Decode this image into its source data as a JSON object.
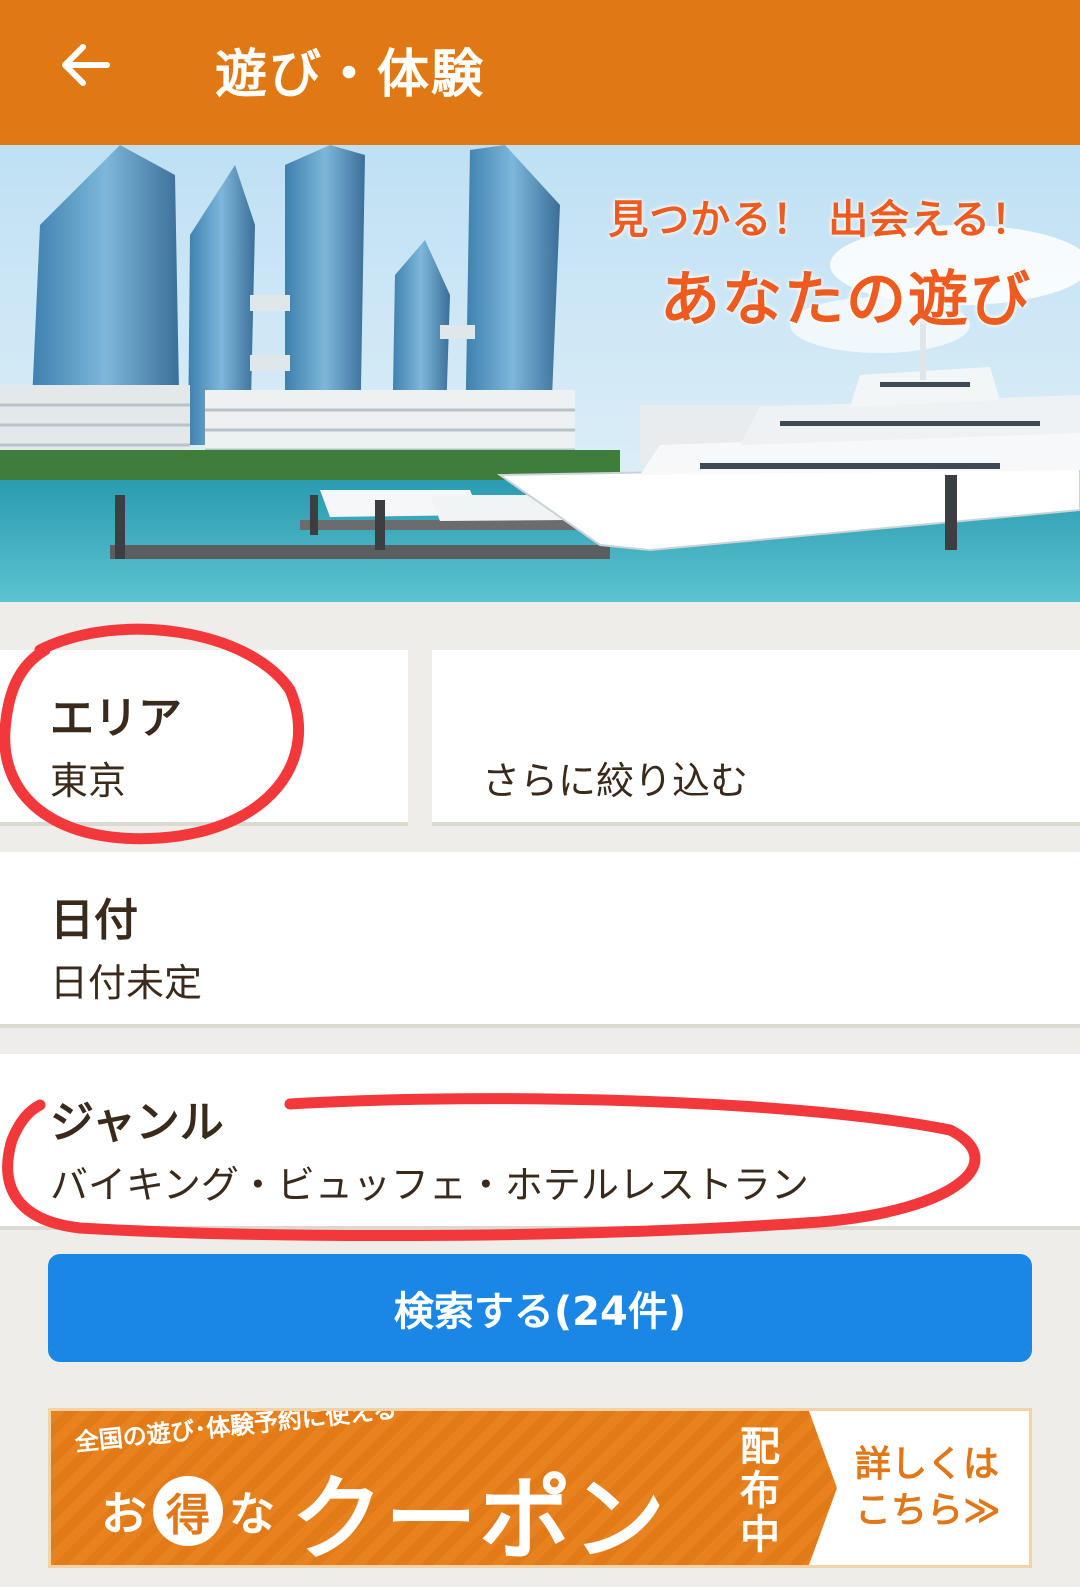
{
  "header": {
    "title": "遊び・体験",
    "back_icon": "arrow-left-icon"
  },
  "hero": {
    "tagline_line1": "見つかる！ 出会える！",
    "tagline_line2": "あなたの遊び"
  },
  "filters": {
    "area": {
      "label": "エリア",
      "value": "東京"
    },
    "refine": {
      "label": "さらに絞り込む"
    },
    "date": {
      "label": "日付",
      "value": "日付未定"
    },
    "genre": {
      "label": "ジャンル",
      "value": "バイキング・ビュッフェ・ホテルレストラン"
    }
  },
  "search": {
    "label": "検索する(24件)"
  },
  "coupon": {
    "subtitle": "全国の遊び･体験予約に使える",
    "prefix": "お",
    "circle_char": "得",
    "middle": "な",
    "main": "クーポン",
    "vertical": "配布中",
    "detail_line1": "詳しくは",
    "detail_line2": "こちら≫"
  },
  "colors": {
    "header_bg": "#e07814",
    "search_bg": "#1a87e6",
    "annotation_red": "#f2383a"
  }
}
